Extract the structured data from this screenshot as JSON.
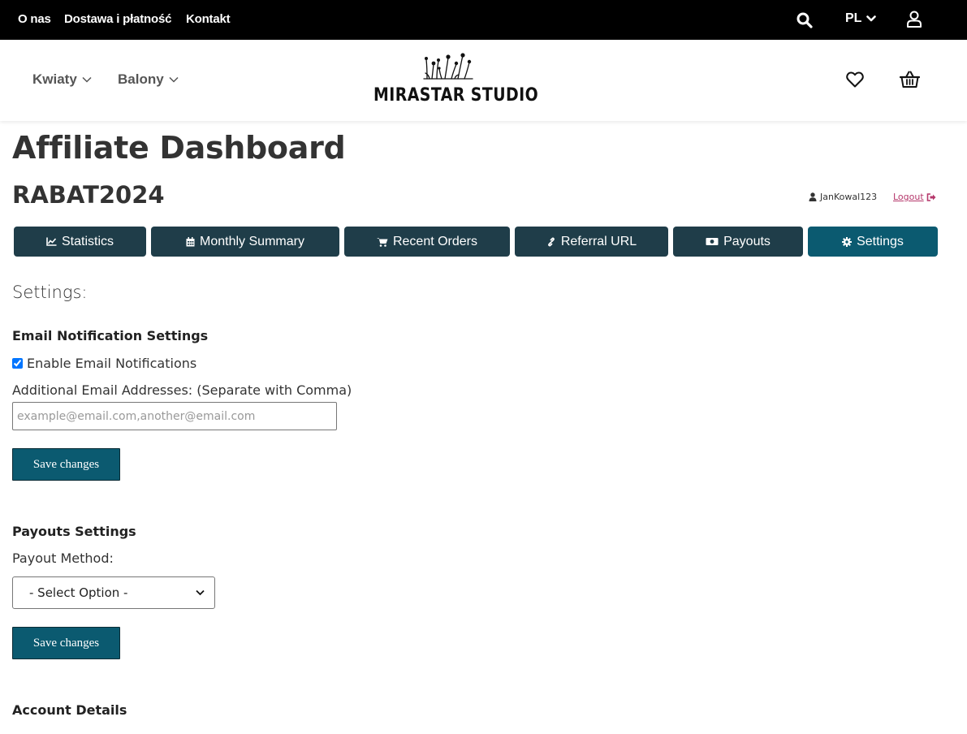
{
  "topbar": {
    "links": [
      "O nas",
      "Dostawa i płatność",
      "Kontakt"
    ],
    "language": "PL",
    "icons": [
      "search-icon",
      "chevron-down-icon",
      "user-icon"
    ]
  },
  "header": {
    "nav": [
      {
        "label": "Kwiaty"
      },
      {
        "label": "Balony"
      }
    ],
    "logo_text": "MIRASTAR STUDIO",
    "icons": [
      "heart-icon",
      "basket-icon"
    ]
  },
  "dashboard": {
    "title": "Affiliate Dashboard",
    "affiliate_code": "RABAT2024",
    "username": "JanKowal123",
    "logout_label": "Logout"
  },
  "tabs": [
    {
      "label": "Statistics",
      "icon": "chart-icon"
    },
    {
      "label": "Monthly Summary",
      "icon": "calendar-icon"
    },
    {
      "label": "Recent Orders",
      "icon": "cart-icon"
    },
    {
      "label": "Referral URL",
      "icon": "link-icon"
    },
    {
      "label": "Payouts",
      "icon": "money-icon"
    },
    {
      "label": "Settings",
      "icon": "gear-icon",
      "active": true
    }
  ],
  "settings": {
    "heading": "Settings:",
    "email": {
      "title": "Email Notification Settings",
      "enable_label": "Enable Email Notifications",
      "enabled": true,
      "additional_label": "Additional Email Addresses: (Separate with Comma)",
      "additional_value": "",
      "additional_placeholder": "example@email.com,another@email.com",
      "save_label": "Save changes"
    },
    "payouts": {
      "title": "Payouts Settings",
      "method_label": "Payout Method:",
      "method_selected": "- Select Option -",
      "save_label": "Save changes"
    },
    "account": {
      "title": "Account Details"
    }
  },
  "colors": {
    "topbar": "#000000",
    "tab": "#1f3d49",
    "tab_active": "#0b5a70",
    "button": "#0b5a70",
    "logout": "#b5376b"
  }
}
